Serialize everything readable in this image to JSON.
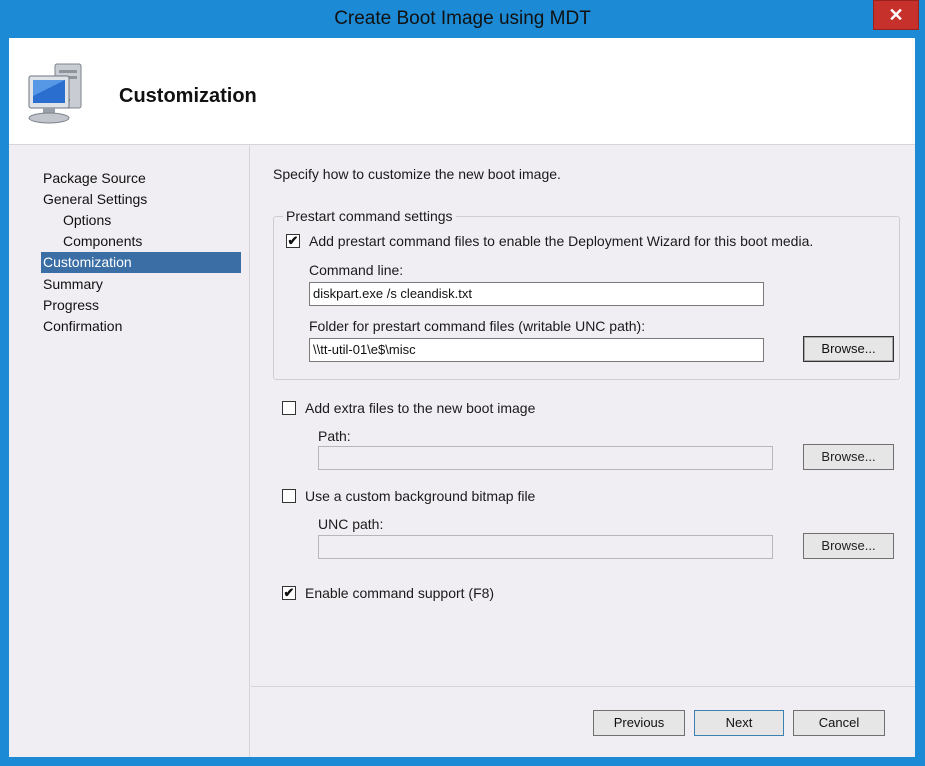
{
  "window": {
    "title": "Create Boot Image using MDT",
    "close_symbol": "✕"
  },
  "header": {
    "title": "Customization",
    "icon": "computer-icon"
  },
  "nav": {
    "items": [
      {
        "label": "Package Source"
      },
      {
        "label": "General Settings"
      },
      {
        "label": "Options"
      },
      {
        "label": "Components"
      },
      {
        "label": "Customization"
      },
      {
        "label": "Summary"
      },
      {
        "label": "Progress"
      },
      {
        "label": "Confirmation"
      }
    ],
    "active": "Customization"
  },
  "content": {
    "intro": "Specify how to customize the new boot image.",
    "prestart": {
      "legend": "Prestart command settings",
      "add_label": "Add prestart command files to enable the Deployment Wizard for this boot media.",
      "add_checked": true,
      "command_line_label": "Command line:",
      "command_line_value": "diskpart.exe /s cleandisk.txt",
      "folder_label": "Folder for prestart command files (writable UNC path):",
      "folder_value": "\\\\tt-util-01\\e$\\misc",
      "browse_label": "Browse..."
    },
    "extra_files": {
      "label": "Add extra files to the new boot image",
      "checked": false,
      "path_label": "Path:",
      "path_value": "",
      "browse_label": "Browse..."
    },
    "background": {
      "label": "Use a custom background bitmap file",
      "checked": false,
      "unc_label": "UNC path:",
      "unc_value": "",
      "browse_label": "Browse..."
    },
    "command_support": {
      "label": "Enable command support (F8)",
      "checked": true
    }
  },
  "footer": {
    "previous": "Previous",
    "next": "Next",
    "cancel": "Cancel"
  },
  "colors": {
    "frame": "#1c8ad4",
    "close": "#c7312c",
    "selection": "#3a6ea5",
    "panel": "#f0eef2"
  }
}
